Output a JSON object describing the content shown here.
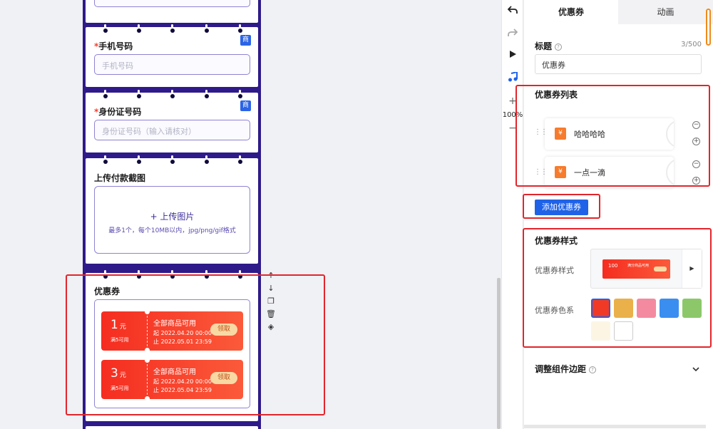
{
  "canvas": {
    "phone_number_field": {
      "label": "手机号码",
      "placeholder": "手机号码",
      "badge": "商"
    },
    "id_card_field": {
      "label": "身份证号码",
      "placeholder": "身份证号码（输入请核对）",
      "badge": "商"
    },
    "upload_field": {
      "label": "上传付款截图",
      "button": "+ 上传图片",
      "hint": "最多1个，每个10MB以内，jpg/png/gif格式"
    },
    "coupon_component": {
      "label": "优惠券",
      "coupons": [
        {
          "amount": "1",
          "unit": "元",
          "condition": "满5可用",
          "name": "全部商品可用",
          "start": "起 2022.04.20 00:00",
          "end": "止 2022.05.01 23:59",
          "button": "领取"
        },
        {
          "amount": "3",
          "unit": "元",
          "condition": "满5可用",
          "name": "全部商品可用",
          "start": "起 2022.04.20 00:00",
          "end": "止 2022.05.04 23:59",
          "button": "领取"
        }
      ]
    },
    "side_tools": [
      {
        "name": "move-up-icon",
        "glyph": "↑"
      },
      {
        "name": "move-down-icon",
        "glyph": "↓"
      },
      {
        "name": "copy-icon",
        "glyph": "❐"
      },
      {
        "name": "delete-icon",
        "glyph": "🗑"
      },
      {
        "name": "layers-icon",
        "glyph": "◈"
      }
    ]
  },
  "toolbar": {
    "undo": "undo-icon",
    "redo": "redo-icon",
    "play": "play-icon",
    "music": "music-icon",
    "zoom_in": "+",
    "zoom_level": "100%",
    "zoom_out": "−"
  },
  "panel": {
    "tabs": [
      "优惠券",
      "动画"
    ],
    "title_label": "标题",
    "title_counter": "3/500",
    "title_value": "优惠券",
    "coupon_list_label": "优惠券列表",
    "coupon_list": [
      {
        "name": "哈哈哈哈"
      },
      {
        "name": "一点一滴"
      }
    ],
    "add_button": "添加优惠券",
    "style_section_label": "优惠券样式",
    "style_row_label": "优惠券样式",
    "style_preview": {
      "amount": "100",
      "text": "满分商品可用"
    },
    "color_row_label": "优惠券色系",
    "color_swatches": [
      {
        "name": "red",
        "color": "#f03a25",
        "selected": true
      },
      {
        "name": "gold",
        "color": "#eab04a"
      },
      {
        "name": "pink",
        "color": "#f48aa0"
      },
      {
        "name": "blue",
        "color": "#3a8ef0"
      },
      {
        "name": "green",
        "color": "#8cc86a"
      },
      {
        "name": "cream",
        "color": "#fdf5e4"
      },
      {
        "name": "white",
        "color": "#ffffff"
      }
    ],
    "margin_section_label": "调整组件边距"
  },
  "colors": {
    "accent": "#1f62e8",
    "phone_frame": "#2f1a8a",
    "annotation": "#e2252b",
    "coupon_red": "#f52d20"
  }
}
